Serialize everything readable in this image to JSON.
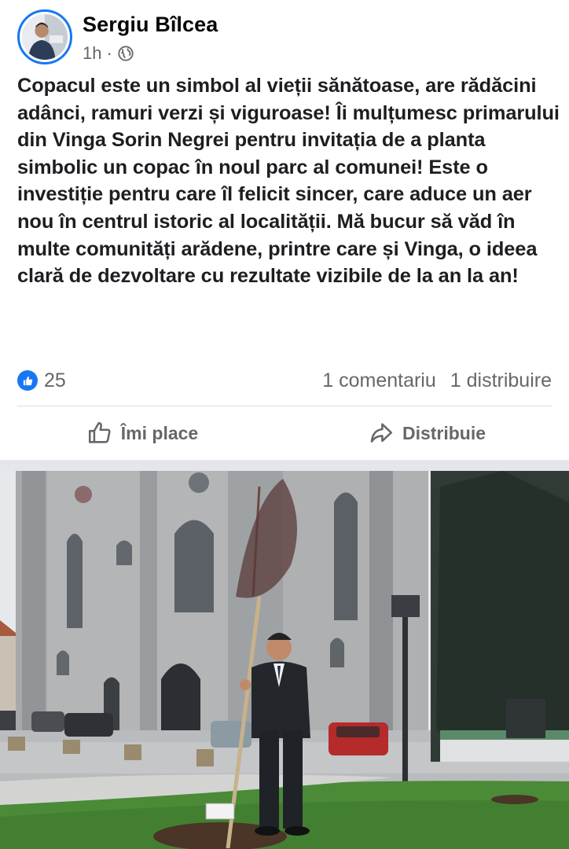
{
  "post": {
    "author": "Sergiu Bîlcea",
    "time": "1h",
    "separator": "·",
    "audience_icon": "globe-icon",
    "text": "Copacul este un simbol al vieții sănătoase, are rădăcini adânci, ramuri verzi și viguroase! Îi mulțumesc primarului din Vinga Sorin Negrei pentru invitația de a planta simbolic un copac în noul parc al comunei! Este o investiție pentru care îl felicit sincer, care aduce un aer nou în centrul istoric al localității. Mă bucur să văd în multe comunități arădene, printre care și Vinga, o ideea clară de dezvoltare cu rezultate vizibile de la an la an!"
  },
  "stats": {
    "like_count": "25",
    "comments": "1 comentariu",
    "shares": "1 distribuire"
  },
  "actions": {
    "like_label": "Îmi place",
    "share_label": "Distribuie"
  },
  "colors": {
    "accent": "#1877f2",
    "secondary_text": "#65676b",
    "divider": "#dadde1"
  }
}
